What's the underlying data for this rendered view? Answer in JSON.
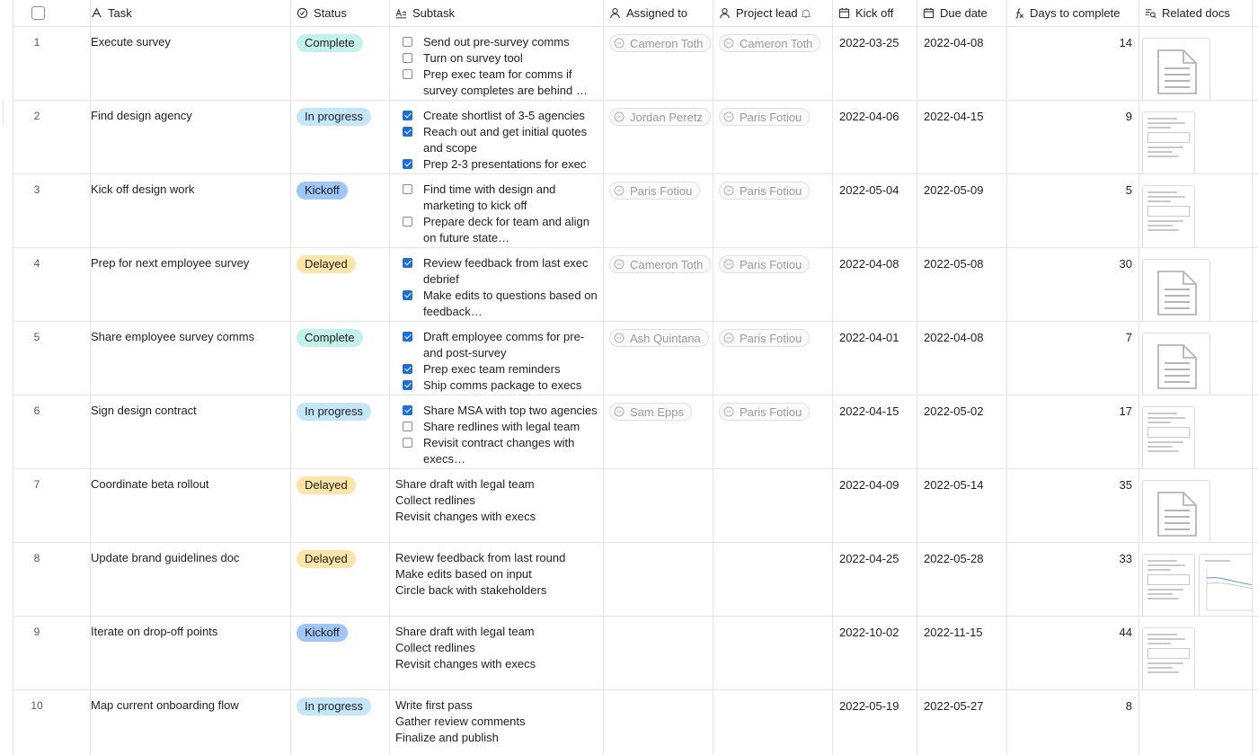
{
  "columns": {
    "task": "Task",
    "status": "Status",
    "subtask": "Subtask",
    "assigned": "Assigned to",
    "lead": "Project lead",
    "kickoff": "Kick off",
    "due": "Due date",
    "days": "Days to complete",
    "docs": "Related docs"
  },
  "status_colors": {
    "Complete": "#c3f2ea",
    "In progress": "#c4e6fb",
    "Kickoff": "#9fc6f7",
    "Delayed": "#fde4a8"
  },
  "icons": {
    "task": "text-icon",
    "status": "status-circle-icon",
    "subtask": "long-text-icon",
    "assigned": "person-icon",
    "lead": "person-icon",
    "kickoff": "calendar-icon",
    "due": "calendar-icon",
    "days": "formula-icon",
    "docs": "lookup-icon"
  },
  "rows": [
    {
      "num": "1",
      "task": "Execute survey",
      "status": "Complete",
      "subtasks": [
        {
          "text": "Send out pre-survey comms",
          "checked": false
        },
        {
          "text": "Turn on survey tool",
          "checked": false
        },
        {
          "text": "Prep exec team for comms if survey completes are behind …",
          "checked": false
        }
      ],
      "subtask_type": "checklist",
      "assigned": "Cameron Toth",
      "lead": "Cameron Toth",
      "kickoff": "2022-03-25",
      "due": "2022-04-08",
      "days": "14",
      "docs": [
        "generic"
      ]
    },
    {
      "num": "2",
      "task": "Find design agency",
      "status": "In progress",
      "subtasks": [
        {
          "text": "Create shortlist of 3-5 agencies",
          "checked": true
        },
        {
          "text": "Reach out and get initial quotes and scope",
          "checked": true
        },
        {
          "text": "Prep 2-3 presentations for exec …",
          "checked": true
        }
      ],
      "subtask_type": "checklist",
      "assigned": "Jordan Peretz",
      "lead": "Paris Fotiou",
      "kickoff": "2022-04-06",
      "due": "2022-04-15",
      "days": "9",
      "docs": [
        "doc"
      ]
    },
    {
      "num": "3",
      "task": "Kick off design work",
      "status": "Kickoff",
      "subtasks": [
        {
          "text": "Find time with design and marketing to kick off",
          "checked": false
        },
        {
          "text": "Prepare deck for team and align on future state…",
          "checked": false
        }
      ],
      "subtask_type": "checklist",
      "assigned": "Paris Fotiou",
      "lead": "Paris Fotiou",
      "kickoff": "2022-05-04",
      "due": "2022-05-09",
      "days": "5",
      "docs": [
        "doc"
      ]
    },
    {
      "num": "4",
      "task": "Prep for next employee survey",
      "status": "Delayed",
      "subtasks": [
        {
          "text": "Review feedback from last exec debrief",
          "checked": true
        },
        {
          "text": "Make edits to questions based on feedback…",
          "checked": true
        }
      ],
      "subtask_type": "checklist",
      "assigned": "Cameron Toth",
      "lead": "Paris Fotiou",
      "kickoff": "2022-04-08",
      "due": "2022-05-08",
      "days": "30",
      "docs": [
        "generic"
      ]
    },
    {
      "num": "5",
      "task": "Share employee survey comms",
      "status": "Complete",
      "subtasks": [
        {
          "text": "Draft employee comms for pre- and post-survey",
          "checked": true
        },
        {
          "text": "Prep exec team reminders",
          "checked": true
        },
        {
          "text": "Ship comms package to execs fo…",
          "checked": true
        }
      ],
      "subtask_type": "checklist",
      "assigned": "Ash Quintana",
      "lead": "Paris Fotiou",
      "kickoff": "2022-04-01",
      "due": "2022-04-08",
      "days": "7",
      "docs": [
        "generic"
      ]
    },
    {
      "num": "6",
      "task": "Sign design contract",
      "status": "In progress",
      "subtasks": [
        {
          "text": "Share MSA with top two agencies",
          "checked": true
        },
        {
          "text": "Share redlines with legal team",
          "checked": false
        },
        {
          "text": "Revisit contract changes with execs…",
          "checked": false
        }
      ],
      "subtask_type": "checklist",
      "assigned": "Sam Epps",
      "lead": "Paris Fotiou",
      "kickoff": "2022-04-15",
      "due": "2022-05-02",
      "days": "17",
      "docs": [
        "doc"
      ]
    },
    {
      "num": "7",
      "task": "Coordinate beta rollout",
      "status": "Delayed",
      "subtasks": [
        {
          "text": "Share draft with legal team"
        },
        {
          "text": "Collect redlines"
        },
        {
          "text": "Revisit changes with execs"
        }
      ],
      "subtask_type": "plain",
      "assigned": "",
      "lead": "",
      "kickoff": "2022-04-09",
      "due": "2022-05-14",
      "days": "35",
      "docs": [
        "generic"
      ]
    },
    {
      "num": "8",
      "task": "Update brand guidelines doc",
      "status": "Delayed",
      "subtasks": [
        {
          "text": "Review feedback from last round"
        },
        {
          "text": "Make edits based on input"
        },
        {
          "text": "Circle back with stakeholders"
        }
      ],
      "subtask_type": "plain",
      "assigned": "",
      "lead": "",
      "kickoff": "2022-04-25",
      "due": "2022-05-28",
      "days": "33",
      "docs": [
        "doc",
        "chart"
      ]
    },
    {
      "num": "9",
      "task": "Iterate on drop-off points",
      "status": "Kickoff",
      "subtasks": [
        {
          "text": "Share draft with legal team"
        },
        {
          "text": "Collect redlines"
        },
        {
          "text": "Revisit changes with execs"
        }
      ],
      "subtask_type": "plain",
      "assigned": "",
      "lead": "",
      "kickoff": "2022-10-02",
      "due": "2022-11-15",
      "days": "44",
      "docs": [
        "doc"
      ]
    },
    {
      "num": "10",
      "task": "Map current onboarding flow",
      "status": "In progress",
      "subtasks": [
        {
          "text": "Write first pass"
        },
        {
          "text": "Gather review comments"
        },
        {
          "text": "Finalize and publish"
        }
      ],
      "subtask_type": "plain",
      "assigned": "",
      "lead": "",
      "kickoff": "2022-05-19",
      "due": "2022-05-27",
      "days": "8",
      "docs": []
    }
  ]
}
